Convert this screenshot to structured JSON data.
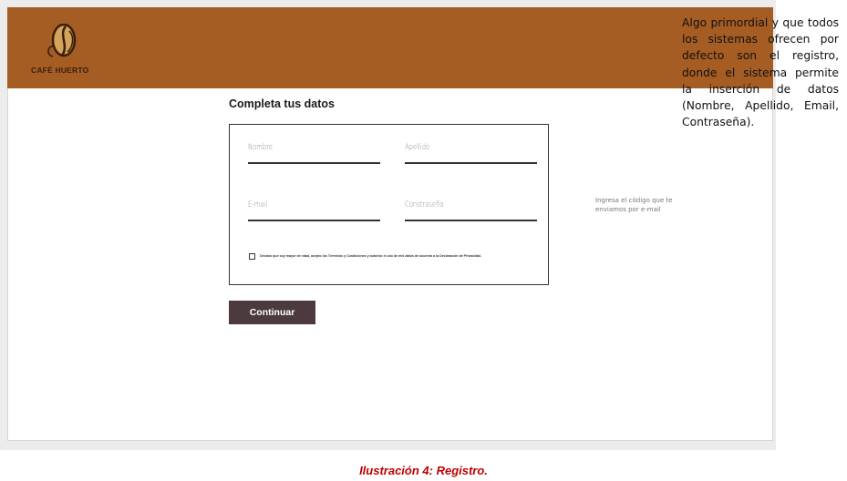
{
  "brand": {
    "name": "CAFÉ HUERTO"
  },
  "form": {
    "title": "Completa tus datos",
    "fields": {
      "nombre": {
        "placeholder": "Nombre"
      },
      "apellido": {
        "placeholder": "Apellido"
      },
      "email": {
        "placeholder": "E-mail"
      },
      "password": {
        "placeholder": "Constraseña"
      }
    },
    "terms": "Declaro que soy mayor de edad, acepto los Términos y Condiciones y autorizo el uso de mis datos de acuerdo a la Declaración de Privacidad.",
    "continue_label": "Continuar"
  },
  "hint": "Ingresa el código que te enviamos por e-mail",
  "side_note": "Algo primordial y que todos los sistemas ofrecen por defecto son el registro, donde el sistema permite la inserción de datos (Nombre, Apellido, Email, Contraseña).",
  "caption": "Ilustración 4: Registro.",
  "colors": {
    "header": "#a55d23",
    "button": "#4c3a3e",
    "caption": "#c00000"
  },
  "icons": {
    "logo": "coffee-bean-logo-icon"
  }
}
